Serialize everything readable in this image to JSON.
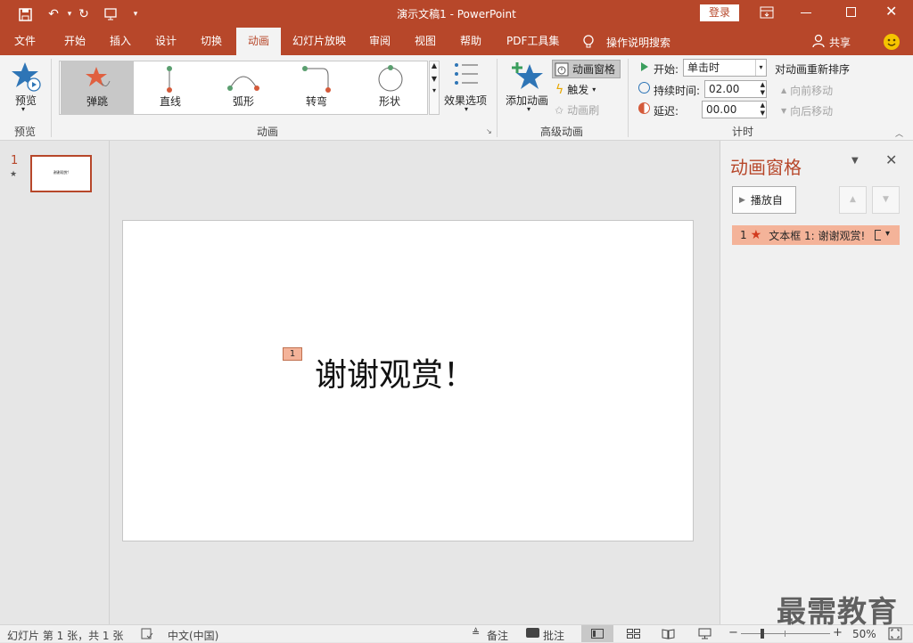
{
  "title": {
    "doc_title": "演示文稿1  -  PowerPoint",
    "login_label": "登录"
  },
  "tabs": [
    "文件",
    "开始",
    "插入",
    "设计",
    "切换",
    "动画",
    "幻灯片放映",
    "审阅",
    "视图",
    "帮助",
    "PDF工具集"
  ],
  "tell_me": "操作说明搜索",
  "share_label": "共享",
  "ribbon": {
    "preview_label": "预览",
    "preview_group": "预览",
    "gallery": [
      "弹跳",
      "直线",
      "弧形",
      "转弯",
      "形状"
    ],
    "effect_options": "效果选项",
    "animation_group": "动画",
    "add_animation": "添加动画",
    "animation_pane": "动画窗格",
    "trigger": "触发",
    "animation_painter": "动画刷",
    "advanced_group": "高级动画",
    "start_label": "开始:",
    "start_value": "单击时",
    "duration_label": "持续时间:",
    "duration_value": "02.00",
    "delay_label": "延迟:",
    "delay_value": "00.00",
    "reorder_title": "对动画重新排序",
    "move_earlier": "向前移动",
    "move_later": "向后移动",
    "timing_group": "计时"
  },
  "thumbs": {
    "number": "1",
    "star": "★",
    "mini_text": "谢谢观赏!"
  },
  "slide": {
    "badge": "1",
    "text": "谢谢观赏！"
  },
  "pane": {
    "title": "动画窗格",
    "play_label": "播放自",
    "item_number": "1",
    "item_label": "文本框 1: 谢谢观赏!"
  },
  "status": {
    "slide_info": "幻灯片 第 1 张，共 1 张",
    "language": "中文(中国)",
    "notes": "备注",
    "comments": "批注",
    "zoom": "50%"
  },
  "watermark": "最需教育",
  "colors": {
    "accent": "#b7472a",
    "star": "#e06040"
  }
}
